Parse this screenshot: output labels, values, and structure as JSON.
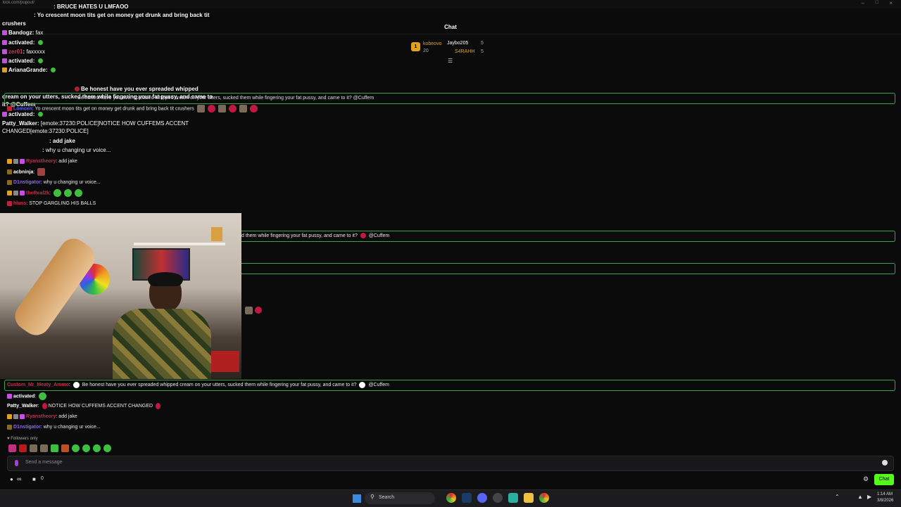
{
  "window": {
    "title": "Chat",
    "url": "kick.com/popout/"
  },
  "leaderboard": {
    "first": {
      "rank": "1",
      "name": "kobeovo",
      "value": "20"
    },
    "second": {
      "name": "Jaybo205",
      "value": "5"
    },
    "third": {
      "name": "S4RAHH",
      "value": "5"
    }
  },
  "overlay_chat": [
    {
      "user": "BRUCE HATES U LMFAOO",
      "text": ""
    },
    {
      "user": "",
      "text": "Yo crescent moon tits get on money get drunk and bring back tit"
    },
    {
      "user": "",
      "text": "crushers"
    },
    {
      "user": "Bandogz",
      "text": "fax"
    },
    {
      "user": "activated",
      "text": ""
    },
    {
      "user": "zer01",
      "text": "faxxxxx"
    },
    {
      "user": "activated",
      "text": ""
    },
    {
      "user": "ArianaGrande",
      "text": ""
    },
    {
      "user": "",
      "text": "Be honest have you ever spreaded whipped"
    },
    {
      "user": "",
      "text": "cream on your utters, sucked them while fingering your fat pussy, and came to"
    },
    {
      "user": "",
      "text": "it? @Cuffem"
    },
    {
      "user": "activated",
      "text": ""
    },
    {
      "user": "Patty_Walker",
      "text": "[emote:37230:POLICE]NOTICE HOW CUFFEMS ACCENT"
    },
    {
      "user": "",
      "text": "CHANGED[emote:37230:POLICE]"
    },
    {
      "user": "",
      "text": "add jake"
    },
    {
      "user": "",
      "text": "why u changing ur voice..."
    }
  ],
  "chat": {
    "messages_top": [
      {
        "user": "",
        "text": "Be honest have you ever spreaded whipped cream on your utters, sucked them while fingering your fat pussy, and came to it? @Cuffem"
      },
      {
        "user": "Lomcen",
        "text": "Yo crescent moon tits get on money get drunk and bring back tit crushers"
      },
      {
        "user": "",
        "text": "BRUCE HATES U LMFAOO"
      },
      {
        "user": "Ryanstheory",
        "text": "add jake"
      },
      {
        "user": "acbninja",
        "text": ""
      },
      {
        "user": "D1nstigator",
        "text": "why u changing ur voice..."
      },
      {
        "user": "theReal2k",
        "text": ""
      },
      {
        "user": "hluss",
        "text": "STOP GARGLING HIS BALLS"
      }
    ],
    "mid_highlight": "d them while fingering your fat pussy, and came to it?",
    "mid_mention": "@Cuffem",
    "messages_bottom": [
      {
        "user": "Custom_Mr_Meaty_Ammo",
        "text": "Be honest have you ever spreaded whipped cream on your utters, sucked them while fingering your fat pussy, and came to it?",
        "mention": "@Cuffem"
      },
      {
        "user": "activated",
        "text": ""
      },
      {
        "user": "Patty_Walker",
        "text": "NOTICE HOW CUFFEMS ACCENT CHANGED"
      },
      {
        "user": "Ryanstheory",
        "text": "add jake"
      },
      {
        "user": "D1nstigator",
        "text": "why u changing ur voice..."
      }
    ],
    "followers_only": "Followers only",
    "input_placeholder": "Send a message",
    "footer_viewers": "∞",
    "footer_count": "0",
    "send_label": "Chat"
  },
  "taskbar": {
    "search_placeholder": "Search",
    "time": "1:14 AM",
    "date": "3/8/2026"
  },
  "colors": {
    "accent": "#53fc18",
    "highlight_border": "#3fa34d",
    "bg": "#0b0b0c"
  }
}
